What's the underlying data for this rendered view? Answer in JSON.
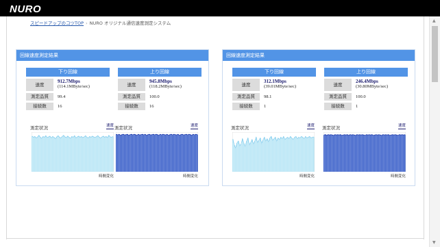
{
  "header": {
    "logo": "NURO"
  },
  "breadcrumb": {
    "link": "スピードアップのコツTOP",
    "separator": "›",
    "current": "NURO オリジナル通信速度測定システム"
  },
  "labels": {
    "panel_title": "回線速度測定結果",
    "down": "下り回線",
    "up": "上り回線",
    "speed": "速度",
    "quality": "測定品質",
    "connections": "接続数",
    "chart_title": "測定状況",
    "chart_link": "速度",
    "chart_axis": "時間変化"
  },
  "colors": {
    "accent": "#5294e6",
    "down_fill": "#b4e4f5",
    "down_stroke": "#7cc9ec",
    "up_fill": "#2f56c6",
    "up_stroke": "#1a36a6"
  },
  "panels": [
    {
      "down": {
        "speed": "912.7Mbps",
        "speed_sub": "(114.1MByte/sec)",
        "quality": "99.4",
        "connections": "16",
        "trace": [
          0.93,
          0.9,
          0.92,
          0.88,
          0.91,
          0.95,
          0.9,
          0.87,
          0.92,
          0.9,
          0.94,
          0.89,
          0.91,
          0.93,
          0.88,
          0.92,
          0.9,
          0.86,
          0.91,
          0.94,
          0.9,
          0.88,
          0.92,
          0.95,
          0.91,
          0.89,
          0.93,
          0.9,
          0.87,
          0.92,
          0.9,
          0.94,
          0.88,
          0.91,
          0.93,
          0.9,
          0.92,
          0.89,
          0.91,
          0.94,
          0.9,
          0.88,
          0.92,
          0.9,
          0.93,
          0.91,
          0.89,
          0.92,
          0.94,
          0.9,
          0.88,
          0.91,
          0.93,
          0.9,
          0.92,
          0.89,
          0.95,
          0.91,
          0.9,
          0.92
        ]
      },
      "up": {
        "speed": "945.8Mbps",
        "speed_sub": "(118.2MByte/sec)",
        "quality": "100.0",
        "connections": "16",
        "trace": [
          0.98,
          0.96,
          0.98,
          0.95,
          0.97,
          0.98,
          0.96,
          0.97,
          0.98,
          0.95,
          0.97,
          0.98,
          0.96,
          0.98,
          0.97,
          0.95,
          0.98,
          0.96,
          0.97,
          0.98,
          0.96,
          0.98,
          0.95,
          0.97,
          0.98,
          0.96,
          0.97,
          0.98,
          0.96,
          0.98,
          0.97,
          0.95,
          0.98,
          0.96,
          0.98,
          0.97,
          0.96,
          0.98,
          0.95,
          0.97,
          0.98,
          0.96,
          0.98,
          0.97,
          0.96,
          0.98,
          0.95,
          0.97,
          0.98,
          0.96,
          0.97,
          0.98,
          0.96,
          0.98,
          0.97,
          0.95,
          0.98,
          0.96,
          0.98,
          0.97
        ]
      }
    },
    {
      "down": {
        "speed": "312.1Mbps",
        "speed_sub": "(39.01MByte/sec)",
        "quality": "98.1",
        "connections": "1",
        "trace": [
          0.85,
          0.7,
          0.62,
          0.75,
          0.8,
          0.68,
          0.72,
          0.86,
          0.74,
          0.66,
          0.8,
          0.88,
          0.7,
          0.76,
          0.84,
          0.72,
          0.8,
          0.9,
          0.76,
          0.82,
          0.88,
          0.74,
          0.83,
          0.9,
          0.8,
          0.86,
          0.78,
          0.88,
          0.92,
          0.82,
          0.86,
          0.9,
          0.8,
          0.88,
          0.84,
          0.9,
          0.86,
          0.92,
          0.84,
          0.88,
          0.9,
          0.86,
          0.92,
          0.88,
          0.84,
          0.9,
          0.92,
          0.86,
          0.9,
          0.88,
          0.92,
          0.9,
          0.86,
          0.92,
          0.88,
          0.9,
          0.92,
          0.88,
          0.9,
          0.91
        ]
      },
      "up": {
        "speed": "246.4Mbps",
        "speed_sub": "(30.80MByte/sec)",
        "quality": "100.0",
        "connections": "1",
        "trace": [
          0.96,
          0.97,
          0.95,
          0.97,
          0.96,
          0.97,
          0.96,
          0.95,
          0.97,
          0.96,
          0.97,
          0.96,
          0.97,
          0.95,
          0.96,
          0.97,
          0.96,
          0.97,
          0.95,
          0.97,
          0.96,
          0.97,
          0.96,
          0.95,
          0.97,
          0.96,
          0.97,
          0.96,
          0.97,
          0.96,
          0.95,
          0.97,
          0.96,
          0.97,
          0.96,
          0.97,
          0.95,
          0.96,
          0.97,
          0.96,
          0.97,
          0.96,
          0.95,
          0.97,
          0.96,
          0.97,
          0.96,
          0.97,
          0.95,
          0.96,
          0.97,
          0.96,
          0.97,
          0.96,
          0.95,
          0.97,
          0.96,
          0.97,
          0.96,
          0.97
        ]
      }
    }
  ]
}
